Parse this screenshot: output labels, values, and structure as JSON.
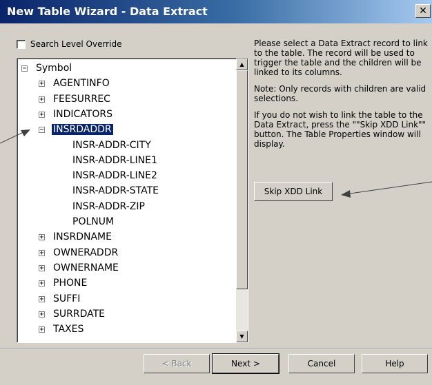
{
  "window": {
    "title": "New Table Wizard - Data Extract",
    "close_glyph": "✕"
  },
  "search_override": {
    "label": "Search Level Override",
    "checked": false
  },
  "tree": {
    "root": {
      "label": "Symbol",
      "expander": "−"
    },
    "items": [
      {
        "label": "AGENTINFO",
        "expander": "+"
      },
      {
        "label": "FEESURREC",
        "expander": "+"
      },
      {
        "label": "INDICATORS",
        "expander": "+"
      },
      {
        "label": "INSRDADDR",
        "expander": "−",
        "selected": true
      },
      {
        "label": "INSR-ADDR-CITY",
        "leaf": true
      },
      {
        "label": "INSR-ADDR-LINE1",
        "leaf": true
      },
      {
        "label": "INSR-ADDR-LINE2",
        "leaf": true
      },
      {
        "label": "INSR-ADDR-STATE",
        "leaf": true
      },
      {
        "label": "INSR-ADDR-ZIP",
        "leaf": true
      },
      {
        "label": "POLNUM",
        "leaf": true
      },
      {
        "label": "INSRDNAME",
        "expander": "+"
      },
      {
        "label": "OWNERADDR",
        "expander": "+"
      },
      {
        "label": "OWNERNAME",
        "expander": "+"
      },
      {
        "label": "PHONE",
        "expander": "+"
      },
      {
        "label": "SUFFI",
        "expander": "+"
      },
      {
        "label": "SURRDATE",
        "expander": "+"
      },
      {
        "label": "TAXES",
        "expander": "+"
      }
    ]
  },
  "scrollbar": {
    "up_glyph": "▲",
    "down_glyph": "▼"
  },
  "help": {
    "paragraph1": "Please select a Data Extract record to link to the table.  The record will be used to trigger the table and the children will be linked to its columns.",
    "paragraph2": "Note: Only records with children are valid selections.",
    "paragraph3": "If you do not wish to link the table to the Data Extract, press the \"\"Skip XDD Link\"\" button.  The Table Properties window will display."
  },
  "buttons": {
    "skip": "Skip XDD Link",
    "back": "< Back",
    "next": "Next >",
    "cancel": "Cancel",
    "help": "Help"
  },
  "icons": {
    "close": "close-icon",
    "expand": "plus-icon",
    "collapse": "minus-icon",
    "arrow": "annotation-arrow-icon"
  },
  "colors": {
    "selection": "#0a246a",
    "dialog": "#d4d0c8",
    "title_start": "#0a246a",
    "title_end": "#a6caf0"
  }
}
